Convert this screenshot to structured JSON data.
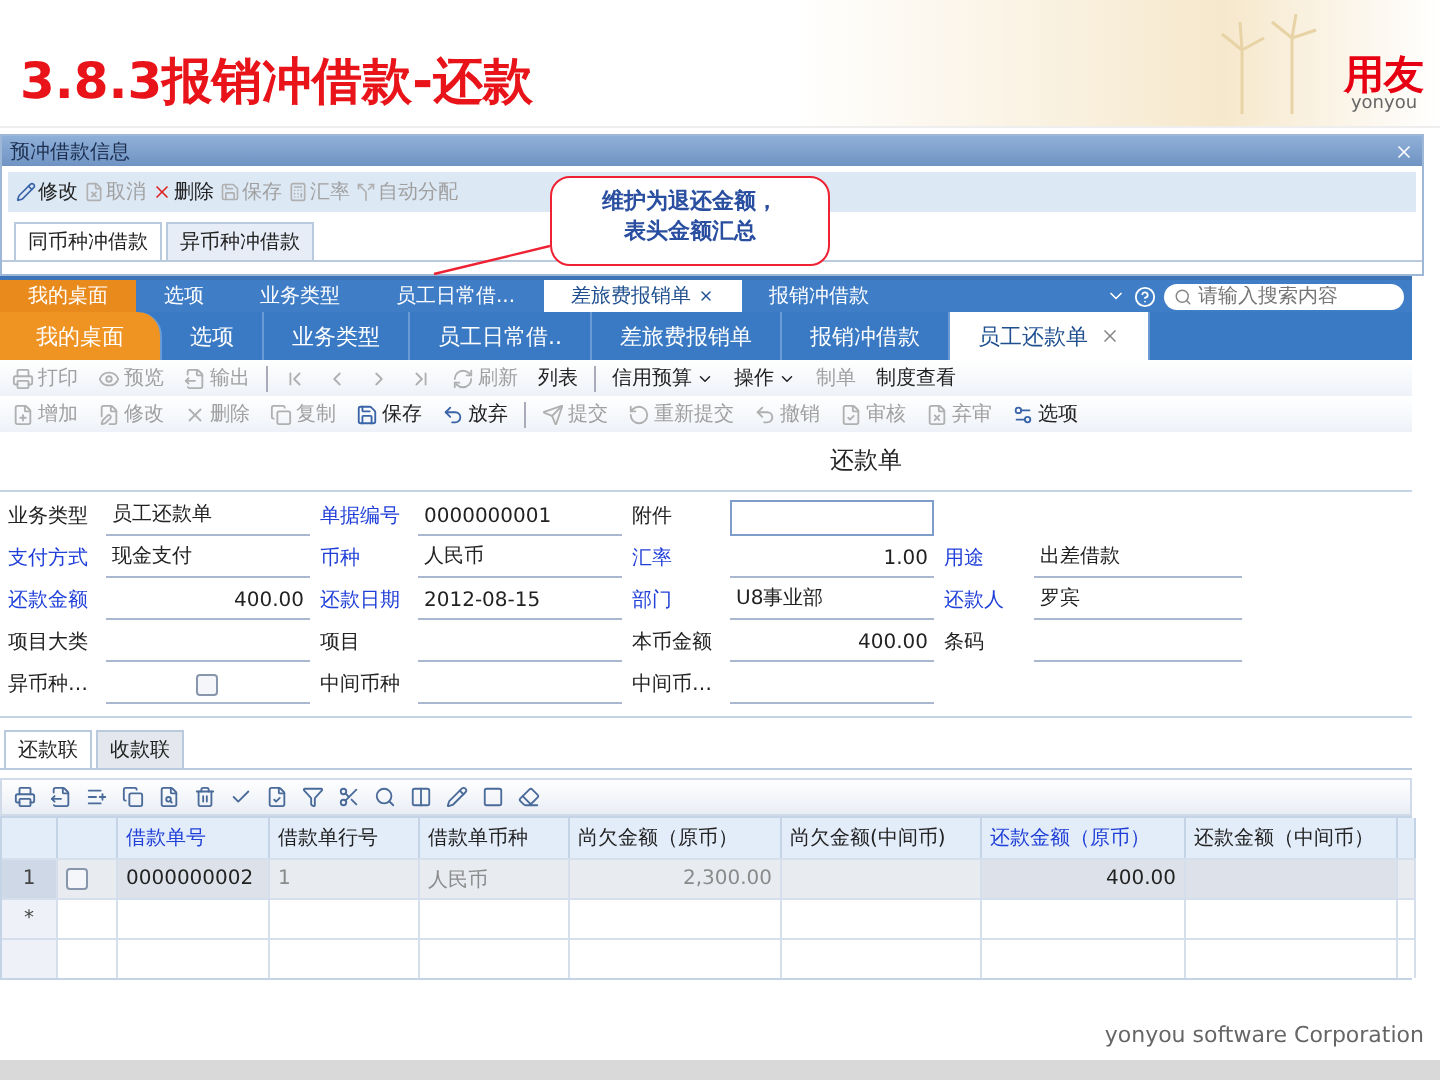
{
  "slide": {
    "title": "3.8.3报销冲借款-还款",
    "logo": "用友",
    "logo_sub": "yonyou",
    "footer": "yonyou software Corporation"
  },
  "dialog": {
    "title": "预冲借款信息",
    "toolbar": [
      {
        "label": "修改",
        "disabled": false
      },
      {
        "label": "取消",
        "disabled": true
      },
      {
        "label": "删除",
        "disabled": false
      },
      {
        "label": "保存",
        "disabled": true
      },
      {
        "label": "汇率",
        "disabled": true
      },
      {
        "label": "自动分配",
        "disabled": true
      }
    ],
    "tabs": [
      {
        "label": "同币种冲借款",
        "selected": true
      },
      {
        "label": "异币种冲借款",
        "selected": false
      }
    ]
  },
  "callout": {
    "lines": [
      "维护为退还金额，",
      "表头金额汇总"
    ]
  },
  "app": {
    "mini_tabs": [
      {
        "label": "我的桌面",
        "kind": "home",
        "selected": false
      },
      {
        "label": "选项",
        "kind": "tab",
        "selected": false
      },
      {
        "label": "业务类型",
        "kind": "tab",
        "selected": false
      },
      {
        "label": "员工日常借...",
        "kind": "tab",
        "selected": false
      },
      {
        "label": "差旅费报销单",
        "kind": "tab",
        "selected": true
      },
      {
        "label": "报销冲借款",
        "kind": "tab",
        "selected": false
      }
    ],
    "search": {
      "placeholder": "请输入搜索内容"
    },
    "tabs": [
      {
        "label": "我的桌面",
        "kind": "home",
        "selected": false
      },
      {
        "label": "选项",
        "kind": "tab",
        "selected": false
      },
      {
        "label": "业务类型",
        "kind": "tab",
        "selected": false
      },
      {
        "label": "员工日常借..",
        "kind": "tab",
        "selected": false
      },
      {
        "label": "差旅费报销单",
        "kind": "tab",
        "selected": false
      },
      {
        "label": "报销冲借款",
        "kind": "tab",
        "selected": false
      },
      {
        "label": "员工还款单",
        "kind": "tab",
        "selected": true
      }
    ],
    "toolbar_rows": [
      [
        {
          "kind": "button",
          "label": "打印",
          "disabled": true
        },
        {
          "kind": "button",
          "label": "预览",
          "disabled": true
        },
        {
          "kind": "button",
          "label": "输出",
          "disabled": true
        },
        {
          "kind": "separator"
        },
        {
          "kind": "nav",
          "disabled": true
        },
        {
          "kind": "nav",
          "disabled": true
        },
        {
          "kind": "nav",
          "disabled": true
        },
        {
          "kind": "nav",
          "disabled": true
        },
        {
          "kind": "button",
          "label": "刷新",
          "disabled": true
        },
        {
          "kind": "text",
          "label": "列表",
          "disabled": false
        },
        {
          "kind": "separator"
        },
        {
          "kind": "dropdown",
          "label": "信用预算",
          "disabled": false
        },
        {
          "kind": "dropdown",
          "label": "操作",
          "disabled": false
        },
        {
          "kind": "text",
          "label": "制单",
          "disabled": true
        },
        {
          "kind": "text",
          "label": "制度查看",
          "disabled": false
        }
      ],
      [
        {
          "kind": "button",
          "label": "增加",
          "disabled": true
        },
        {
          "kind": "button",
          "label": "修改",
          "disabled": true
        },
        {
          "kind": "button",
          "label": "删除",
          "disabled": true
        },
        {
          "kind": "button",
          "label": "复制",
          "disabled": true
        },
        {
          "kind": "button",
          "label": "保存",
          "disabled": false
        },
        {
          "kind": "button",
          "label": "放弃",
          "disabled": false
        },
        {
          "kind": "separator"
        },
        {
          "kind": "button",
          "label": "提交",
          "disabled": true
        },
        {
          "kind": "button",
          "label": "重新提交",
          "disabled": true
        },
        {
          "kind": "button",
          "label": "撤销",
          "disabled": true
        },
        {
          "kind": "button",
          "label": "审核",
          "disabled": true
        },
        {
          "kind": "button",
          "label": "弃审",
          "disabled": true
        },
        {
          "kind": "button",
          "label": "选项",
          "disabled": false
        }
      ]
    ],
    "form": {
      "title": "还款单",
      "rows": [
        [
          {
            "label": "业务类型",
            "required": false,
            "kind": "text",
            "value": "员工还款单"
          },
          {
            "label": "单据编号",
            "required": true,
            "kind": "text",
            "value": "0000000001"
          },
          {
            "label": "附件",
            "required": false,
            "kind": "input"
          }
        ],
        [
          {
            "label": "支付方式",
            "required": true,
            "kind": "text",
            "value": "现金支付"
          },
          {
            "label": "币种",
            "required": true,
            "kind": "text",
            "value": "人民币"
          },
          {
            "label": "汇率",
            "required": true,
            "kind": "amount",
            "value": "1.00"
          },
          {
            "label": "用途",
            "required": true,
            "kind": "text",
            "value": "出差借款"
          }
        ],
        [
          {
            "label": "还款金额",
            "required": true,
            "kind": "amount",
            "value": "400.00"
          },
          {
            "label": "还款日期",
            "required": true,
            "kind": "text",
            "value": "2012-08-15"
          },
          {
            "label": "部门",
            "required": true,
            "kind": "text",
            "value": "U8事业部"
          },
          {
            "label": "还款人",
            "required": true,
            "kind": "text",
            "value": "罗宾"
          }
        ],
        [
          {
            "label": "项目大类",
            "required": false,
            "kind": "text"
          },
          {
            "label": "项目",
            "required": false,
            "kind": "text"
          },
          {
            "label": "本币金额",
            "required": false,
            "kind": "amount",
            "value": "400.00"
          },
          {
            "label": "条码",
            "required": false,
            "kind": "text"
          }
        ],
        [
          {
            "label": "异币种…",
            "required": false,
            "kind": "checkbox",
            "checked": false
          },
          {
            "label": "中间币种",
            "required": false,
            "kind": "text"
          },
          {
            "label": "中间币…",
            "required": false,
            "kind": "text"
          }
        ]
      ]
    },
    "detail_tabs": [
      {
        "label": "还款联",
        "selected": true
      },
      {
        "label": "收款联",
        "selected": false
      }
    ],
    "grid": {
      "columns": [
        {
          "label": "借款单号",
          "required": true,
          "readonly": false,
          "kind": "text"
        },
        {
          "label": "借款单行号",
          "required": false,
          "readonly": true,
          "kind": "text"
        },
        {
          "label": "借款单币种",
          "required": false,
          "readonly": true,
          "kind": "text"
        },
        {
          "label": "尚欠金额（原币）",
          "required": false,
          "readonly": true,
          "kind": "amount"
        },
        {
          "label": "尚欠金额(中间币)",
          "required": false,
          "readonly": true,
          "kind": "amount"
        },
        {
          "label": "还款金额（原币）",
          "required": true,
          "readonly": false,
          "kind": "amount"
        },
        {
          "label": "还款金额（中间币）",
          "required": false,
          "readonly": false,
          "kind": "amount"
        }
      ],
      "rows": [
        {
          "kind": "data",
          "marker": "1",
          "checked": false,
          "selected": true,
          "cells": [
            "0000000002",
            "1",
            "人民币",
            "2,300.00",
            null,
            "400.00",
            null
          ]
        },
        {
          "kind": "new",
          "marker": "*",
          "selected": false
        },
        {
          "kind": "blank",
          "selected": false
        }
      ]
    }
  }
}
